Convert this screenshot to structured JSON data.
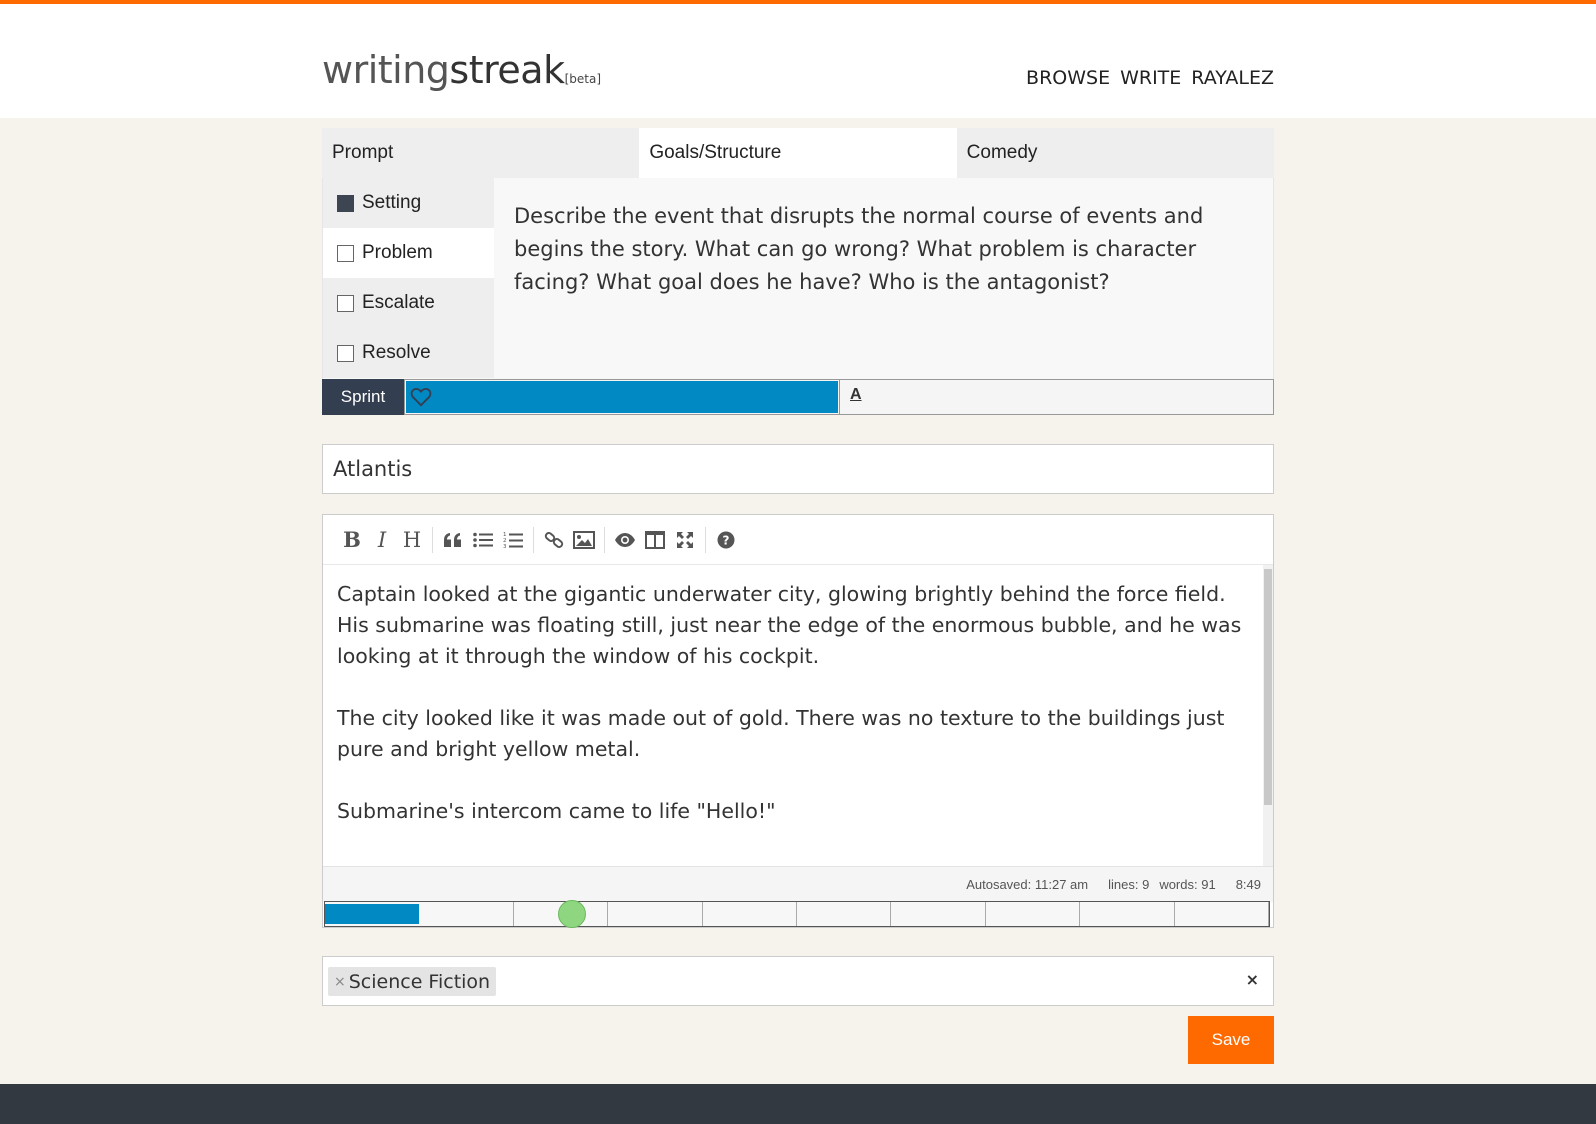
{
  "brand": {
    "light": "writing",
    "bold": "streak",
    "beta": "[beta]"
  },
  "nav": {
    "browse": "BROWSE",
    "write": "WRITE",
    "user": "RAYALEZ"
  },
  "tabs": [
    {
      "label": "Prompt"
    },
    {
      "label": "Goals/Structure",
      "active": true
    },
    {
      "label": "Comedy"
    }
  ],
  "structure": {
    "steps": [
      {
        "label": "Setting",
        "checked": true
      },
      {
        "label": "Problem",
        "checked": false,
        "active": true
      },
      {
        "label": "Escalate",
        "checked": false
      },
      {
        "label": "Resolve",
        "checked": false
      }
    ],
    "description": "Describe the event that disrupts the normal course of events and begins the story. What can go wrong? What problem is character facing? What goal does he have? Who is the antagonist?"
  },
  "sprint": {
    "button": "Sprint",
    "letter": "A",
    "progress": 0.5
  },
  "story": {
    "title": "Atlantis",
    "paragraphs": [
      "Captain looked at the gigantic underwater city, glowing brightly behind the force field. His submarine was floating still, just near the edge of the enormous bubble, and he was looking at it through the window of his cockpit.",
      "The city looked like it was made out of gold. There was no texture to the buildings just pure and bright yellow metal.",
      "Submarine's intercom came to life \"Hello!\""
    ]
  },
  "toolbar": {
    "bold": "B",
    "italic": "I",
    "heading": "H",
    "icons": [
      "bold-icon",
      "italic-icon",
      "heading-icon",
      "quote-icon",
      "unordered-list-icon",
      "ordered-list-icon",
      "link-icon",
      "image-icon",
      "preview-icon",
      "side-by-side-icon",
      "fullscreen-icon",
      "help-icon"
    ]
  },
  "status": {
    "autosaved": "Autosaved: 11:27 am",
    "lines": "lines: 9",
    "words": "words: 91",
    "time": "8:49"
  },
  "word_progress": {
    "segments": 10,
    "filled": 1
  },
  "tags": {
    "items": [
      "Science Fiction"
    ],
    "remove": "×",
    "clear": "×"
  },
  "save_label": "Save",
  "colors": {
    "accent": "#ff6a00",
    "progress": "#0089c3",
    "sprint_button": "#333e50",
    "footer": "#333940"
  }
}
